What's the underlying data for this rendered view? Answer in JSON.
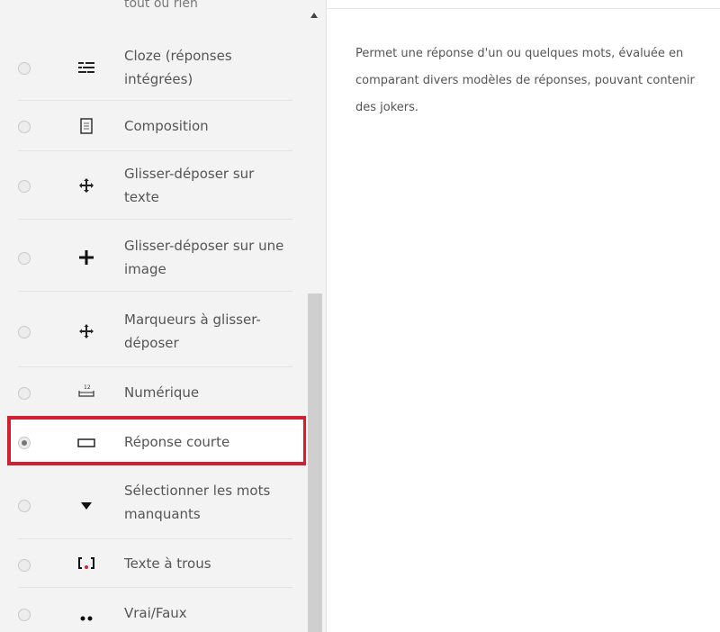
{
  "top_partial_label": "tout ou rien",
  "items": [
    {
      "label": "Cloze (réponses intégrées)",
      "icon": "cloze-icon",
      "selected": false
    },
    {
      "label": "Composition",
      "icon": "document-icon",
      "selected": false
    },
    {
      "label": "Glisser-déposer sur texte",
      "icon": "drag-text-icon",
      "selected": false
    },
    {
      "label": "Glisser-déposer sur une image",
      "icon": "move-cross-icon",
      "selected": false
    },
    {
      "label": "Marqueurs à glisser-déposer",
      "icon": "drag-markers-icon",
      "selected": false
    },
    {
      "label": "Numérique",
      "icon": "numeric-icon",
      "selected": false
    },
    {
      "label": "Réponse courte",
      "icon": "short-answer-icon",
      "selected": true
    },
    {
      "label": "Sélectionner les mots manquants",
      "icon": "select-missing-words-icon",
      "selected": false
    },
    {
      "label": "Texte à trous",
      "icon": "gap-fill-icon",
      "selected": false
    },
    {
      "label": "Vrai/Faux",
      "icon": "true-false-icon",
      "selected": false
    }
  ],
  "description": "Permet une réponse d'un ou quelques mots, évaluée en comparant divers modèles de réponses, pouvant contenir des jokers.",
  "highlight_color": "#d1202f"
}
